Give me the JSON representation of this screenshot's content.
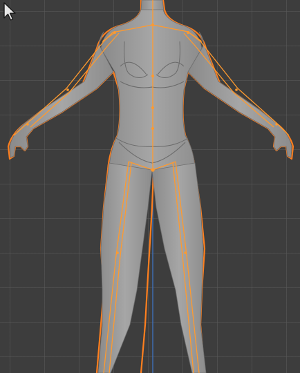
{
  "viewport": {
    "background_color": "#3d3d3d",
    "grid_color": "#5a5a5a",
    "axis_color": "#3f6fb8",
    "selection_outline_color": "#ff7f1e",
    "bone_color": "#ff9a2e",
    "mesh_color": "#9d9d9d"
  },
  "cursor": {
    "icon": "arrow-cursor-icon"
  },
  "scene": {
    "object": "humanoid-mesh",
    "armature": "armature-bones",
    "selected": true
  }
}
